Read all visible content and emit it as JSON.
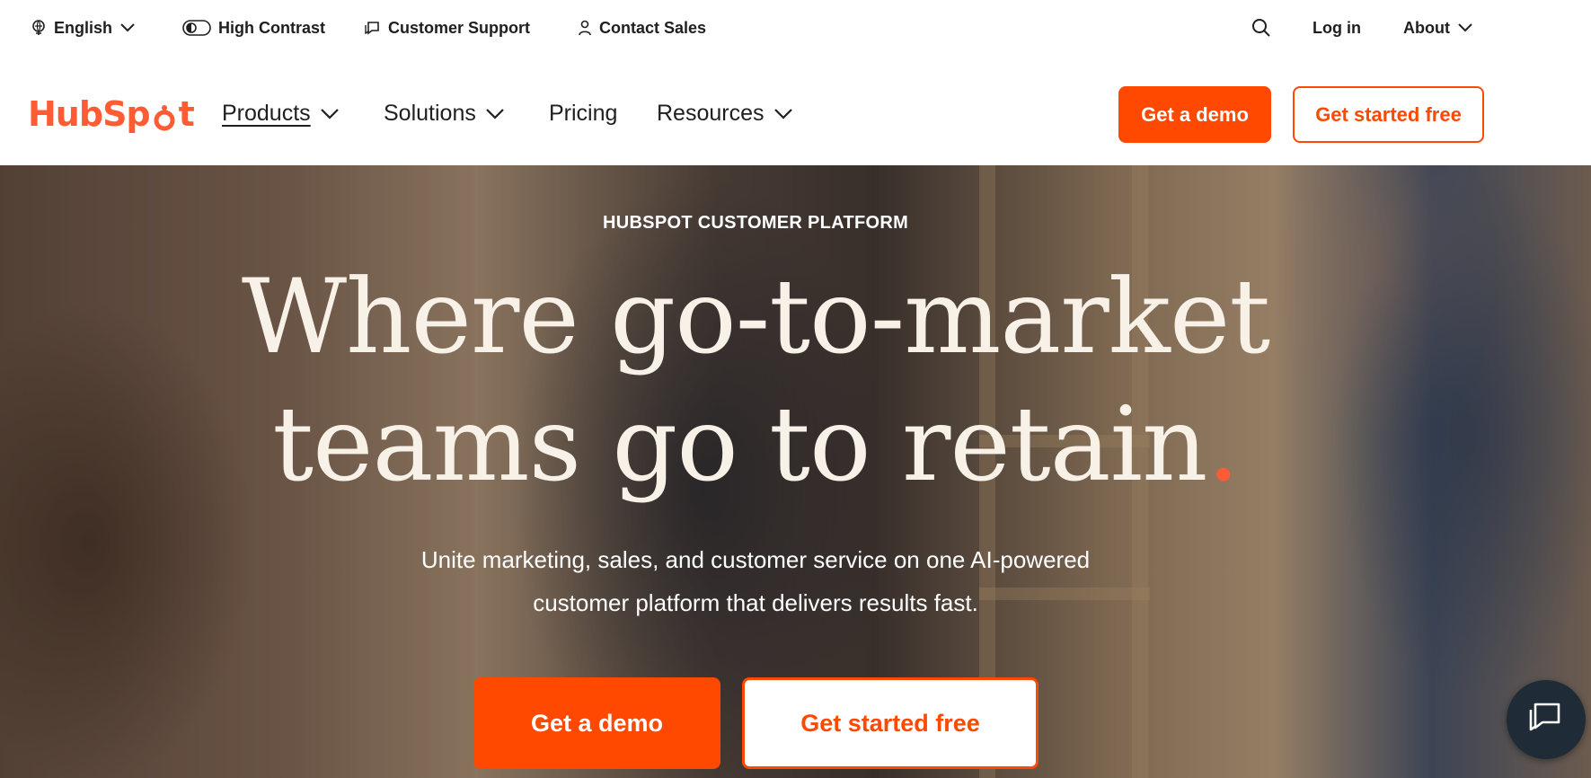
{
  "utility": {
    "language": "English",
    "contrast": "High Contrast",
    "support": "Customer Support",
    "sales": "Contact Sales",
    "login": "Log in",
    "about": "About"
  },
  "nav": {
    "logo": {
      "prefix": "Hub",
      "suffix": "t",
      "middle": "Sp"
    },
    "items": [
      {
        "label": "Products",
        "dropdown": true
      },
      {
        "label": "Solutions",
        "dropdown": true
      },
      {
        "label": "Pricing",
        "dropdown": false
      },
      {
        "label": "Resources",
        "dropdown": true
      }
    ],
    "demo_label": "Get a demo",
    "free_label": "Get started free"
  },
  "hero": {
    "eyebrow": "HUBSPOT CUSTOMER PLATFORM",
    "headline_line1": "Where go-to-market",
    "headline_line2": "teams go to retain",
    "headline_dot": ".",
    "subtitle_line1": "Unite marketing, sales, and customer service on one AI-powered",
    "subtitle_line2": "customer platform that delivers results fast.",
    "demo_label": "Get a demo",
    "free_label": "Get started free"
  },
  "colors": {
    "accent": "#ff4800",
    "brand": "#ff5c35",
    "headline": "#f7f1e8"
  },
  "icons": {
    "language": "globe-icon",
    "contrast": "contrast-toggle-icon",
    "support": "chat-bubble-icon",
    "sales": "person-icon",
    "search": "search-icon",
    "chevron": "chevron-down-icon",
    "chat": "chat-launcher-icon"
  }
}
